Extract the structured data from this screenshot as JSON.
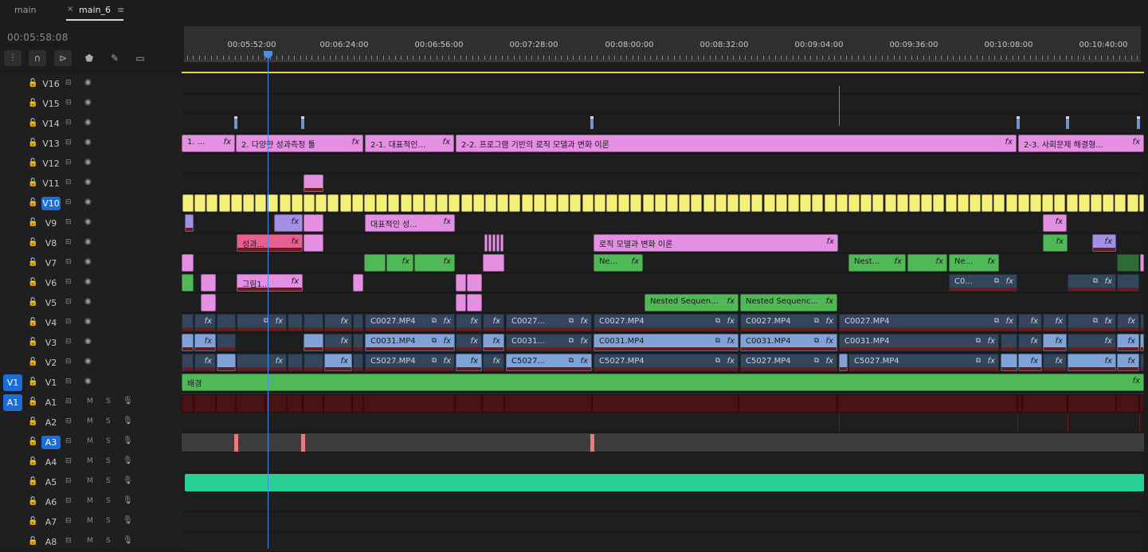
{
  "tabs": [
    {
      "label": "main",
      "close": "",
      "menu": ""
    },
    {
      "label": "main_6",
      "close": "×",
      "menu": "≡"
    }
  ],
  "timecode": "00:05:58:08",
  "tools": [
    "insert-overwrite-icon",
    "snap-icon",
    "linked-selection-icon",
    "marker-icon",
    "wrench-icon",
    "captions-icon"
  ],
  "ruler": {
    "labels": [
      "00:05:52:00",
      "00:06:24:00",
      "00:06:56:00",
      "00:07:28:00",
      "00:08:00:00",
      "00:08:32:00",
      "00:09:04:00",
      "00:09:36:00",
      "00:10:08:00",
      "00:10:40:00"
    ]
  },
  "colors": {
    "playhead": "#4a8ee6",
    "target": "#1c6ed6",
    "workarea": "#e0d84a"
  },
  "tracks": {
    "video": [
      {
        "name": "V16",
        "target": false,
        "source": ""
      },
      {
        "name": "V15",
        "target": false,
        "source": ""
      },
      {
        "name": "V14",
        "target": false,
        "source": ""
      },
      {
        "name": "V13",
        "target": false,
        "source": ""
      },
      {
        "name": "V12",
        "target": false,
        "source": ""
      },
      {
        "name": "V11",
        "target": false,
        "source": ""
      },
      {
        "name": "V10",
        "target": true,
        "source": ""
      },
      {
        "name": "V9",
        "target": false,
        "source": ""
      },
      {
        "name": "V8",
        "target": false,
        "source": ""
      },
      {
        "name": "V7",
        "target": false,
        "source": ""
      },
      {
        "name": "V6",
        "target": false,
        "source": ""
      },
      {
        "name": "V5",
        "target": false,
        "source": ""
      },
      {
        "name": "V4",
        "target": false,
        "source": ""
      },
      {
        "name": "V3",
        "target": false,
        "source": ""
      },
      {
        "name": "V2",
        "target": false,
        "source": ""
      },
      {
        "name": "V1",
        "target": false,
        "source": "V1"
      }
    ],
    "audio": [
      {
        "name": "A1",
        "target": false,
        "source": "A1"
      },
      {
        "name": "A2",
        "target": false,
        "source": ""
      },
      {
        "name": "A3",
        "target": true,
        "source": ""
      },
      {
        "name": "A4",
        "target": false,
        "source": ""
      },
      {
        "name": "A5",
        "target": false,
        "source": ""
      },
      {
        "name": "A6",
        "target": false,
        "source": ""
      },
      {
        "name": "A7",
        "target": false,
        "source": ""
      },
      {
        "name": "A8",
        "target": false,
        "source": ""
      }
    ],
    "mute_label": "M",
    "solo_label": "S"
  },
  "clips": {
    "v13": [
      "1. ...",
      "2. 다양한 성과측정 툴",
      "2-1. 대표적인...",
      "2-2. 프로그램 기반의 로직 모델과 변화 이론",
      "2-3. 사회문제 해결형..."
    ],
    "v9": [
      "대표적인 성..."
    ],
    "v8": [
      "성과...",
      "로직 모델과 변화 이론"
    ],
    "v7": [
      "Ne...",
      "Nest...",
      "Ne..."
    ],
    "v6": [
      "그림1...",
      "C0..."
    ],
    "v5": [
      "Nested Sequen...",
      "Nested Sequenc..."
    ],
    "v4": [
      "C0027.MP4",
      "C0027...",
      "C0027.MP4",
      "C0027.MP4",
      "C0027.MP4"
    ],
    "v3": [
      "C0031.MP4",
      "C0031...",
      "C0031.MP4",
      "C0031.MP4",
      "C0031.MP4"
    ],
    "v2": [
      "C5027.MP4",
      "C5027...",
      "C5027.MP4",
      "C5027.MP4",
      "C5027.MP4"
    ],
    "v1": [
      "배경"
    ],
    "fx": "fx",
    "nested_icon": "⧉"
  }
}
